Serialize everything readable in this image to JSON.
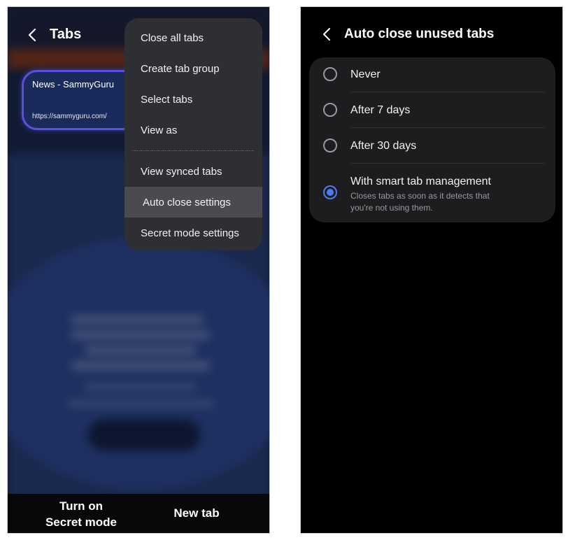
{
  "left_screen": {
    "header": {
      "title": "Tabs"
    },
    "tab_card": {
      "title": "News - SammyGuru",
      "url": "https://sammyguru.com/"
    },
    "menu": {
      "items": [
        "Close all tabs",
        "Create tab group",
        "Select tabs",
        "View as",
        "View synced tabs",
        "Auto close settings",
        "Secret mode settings"
      ],
      "highlighted": "Auto close settings"
    },
    "bottom_bar": {
      "secret_line1": "Turn on",
      "secret_line2": "Secret mode",
      "new_tab": "New tab"
    }
  },
  "right_screen": {
    "header": {
      "title": "Auto close unused tabs"
    },
    "options": [
      {
        "label": "Never",
        "selected": false
      },
      {
        "label": "After 7 days",
        "selected": false
      },
      {
        "label": "After 30 days",
        "selected": false
      },
      {
        "label": "With smart tab management",
        "description_line1": "Closes tabs as soon as it detects that",
        "description_line2": "you're not using them.",
        "selected": true
      }
    ]
  },
  "colors": {
    "accent_radio": "#4c7cf3",
    "tab_card_border": "#5a4fe0",
    "menu_bg": "#2e2f33"
  },
  "icons": [
    "back-chevron-icon"
  ]
}
